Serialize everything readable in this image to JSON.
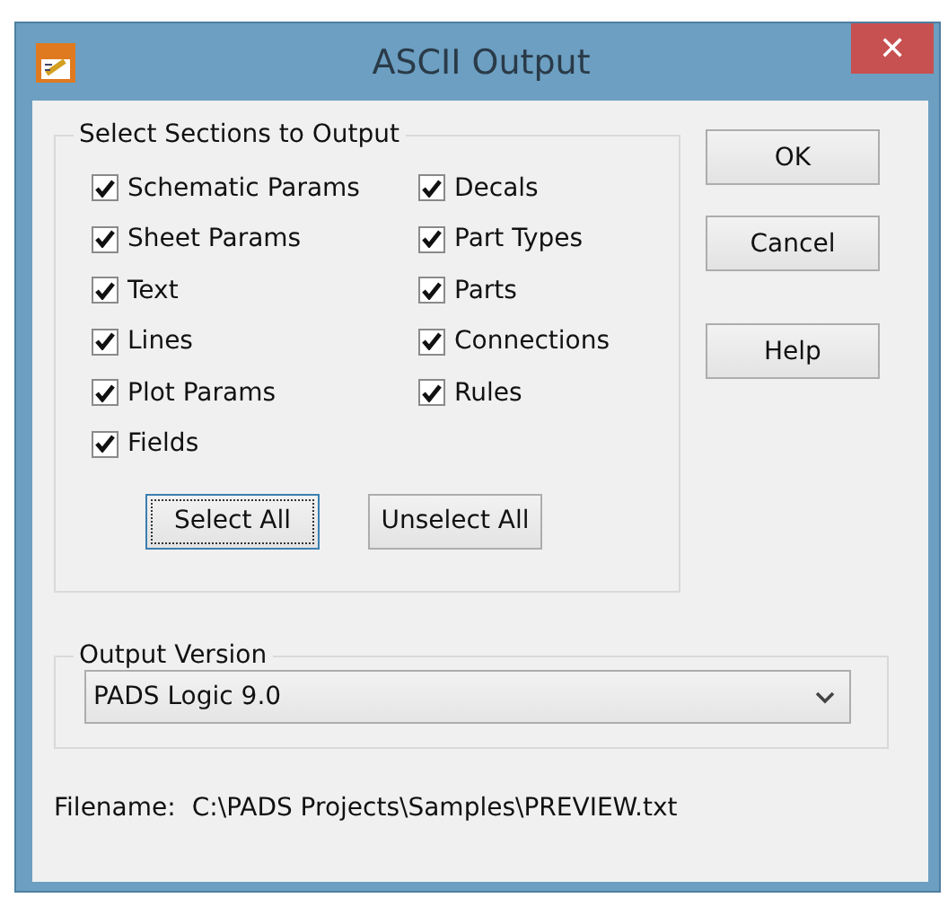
{
  "window": {
    "title": "ASCII Output",
    "close": "✕"
  },
  "sections": {
    "title": "Select Sections to Output",
    "columns": [
      [
        {
          "label": "Schematic Params",
          "checked": true
        },
        {
          "label": "Sheet Params",
          "checked": true
        },
        {
          "label": "Text",
          "checked": true
        },
        {
          "label": "Lines",
          "checked": true
        },
        {
          "label": "Plot Params",
          "checked": true
        },
        {
          "label": "Fields",
          "checked": true
        }
      ],
      [
        {
          "label": "Decals",
          "checked": true
        },
        {
          "label": "Part Types",
          "checked": true
        },
        {
          "label": "Parts",
          "checked": true
        },
        {
          "label": "Connections",
          "checked": true
        },
        {
          "label": "Rules",
          "checked": true
        }
      ]
    ],
    "buttons": [
      {
        "label": "Select All",
        "focused": true
      },
      {
        "label": "Unselect All",
        "focused": false
      }
    ]
  },
  "side_buttons": [
    "OK",
    "Cancel",
    "Help"
  ],
  "output_version": {
    "title": "Output Version",
    "value": "PADS Logic 9.0"
  },
  "filename": {
    "label": "Filename:",
    "value": "C:\\PADS Projects\\Samples\\PREVIEW.txt"
  }
}
